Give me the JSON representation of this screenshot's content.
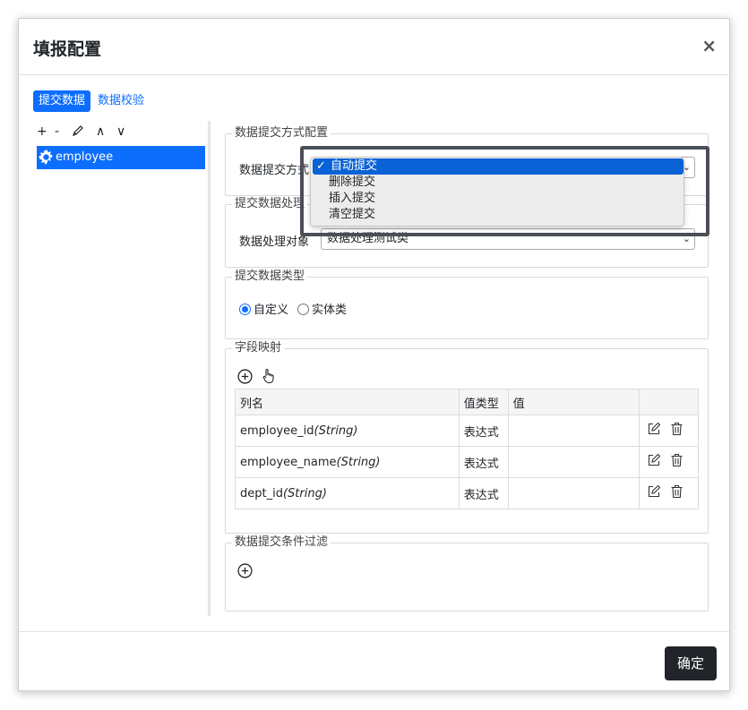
{
  "dialog": {
    "title": "填报配置",
    "close_label": "×",
    "confirm_label": "确定"
  },
  "tabs": [
    {
      "label": "提交数据",
      "active": true
    },
    {
      "label": "数据校验",
      "active": false
    }
  ],
  "tree": {
    "toolbar": {
      "add": "+",
      "remove": "-",
      "up": "∧",
      "down": "∨"
    },
    "items": [
      {
        "label": "employee",
        "selected": true
      }
    ]
  },
  "sections": {
    "submit_method": {
      "legend": "数据提交方式配置",
      "label": "数据提交方式",
      "options": [
        "自动提交",
        "删除提交",
        "插入提交",
        "清空提交"
      ],
      "selected_index": 0
    },
    "processing": {
      "legend": "提交数据处理",
      "label": "数据处理对象",
      "value": "数据处理测试类"
    },
    "data_type": {
      "legend": "提交数据类型",
      "options": [
        "自定义",
        "实体类"
      ],
      "selected": "自定义"
    },
    "field_mapping": {
      "legend": "字段映射",
      "columns": [
        "列名",
        "值类型",
        "值",
        ""
      ],
      "rows": [
        {
          "name": "employee_id",
          "type": "(String)",
          "value_type": "表达式",
          "value": ""
        },
        {
          "name": "employee_name",
          "type": "(String)",
          "value_type": "表达式",
          "value": ""
        },
        {
          "name": "dept_id",
          "type": "(String)",
          "value_type": "表达式",
          "value": ""
        }
      ]
    },
    "filter": {
      "legend": "数据提交条件过滤"
    }
  },
  "colors": {
    "primary": "#0d6efd",
    "dark_button": "#212529",
    "dropdown_selected": "#0a63d6"
  }
}
